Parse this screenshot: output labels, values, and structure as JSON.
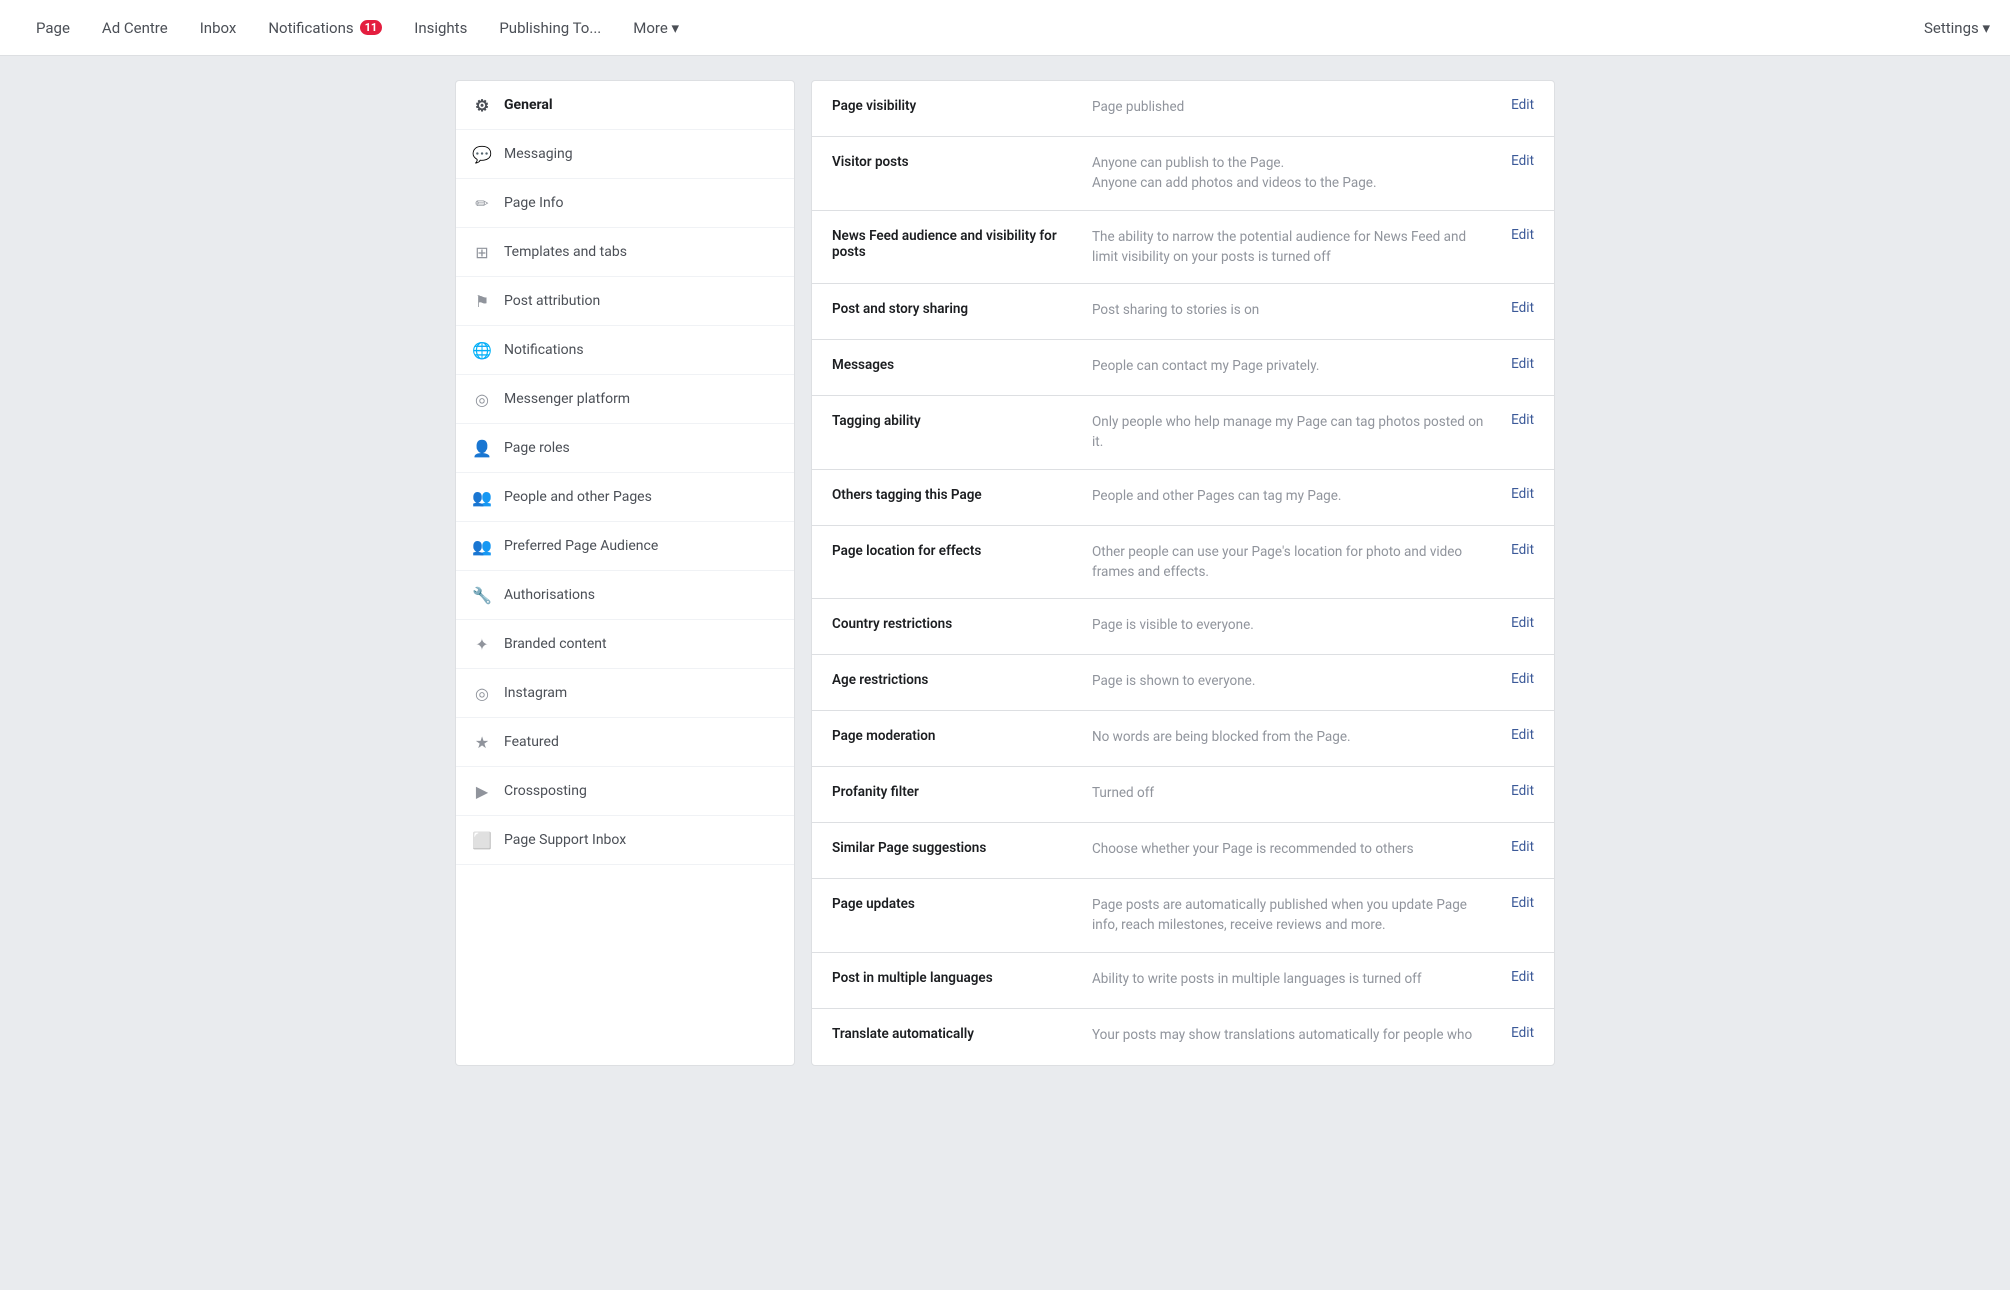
{
  "nav": {
    "items": [
      {
        "id": "page",
        "label": "Page",
        "badge": null
      },
      {
        "id": "ad-centre",
        "label": "Ad Centre",
        "badge": null
      },
      {
        "id": "inbox",
        "label": "Inbox",
        "badge": null
      },
      {
        "id": "notifications",
        "label": "Notifications",
        "badge": "11"
      },
      {
        "id": "insights",
        "label": "Insights",
        "badge": null
      },
      {
        "id": "publishing",
        "label": "Publishing To...",
        "badge": null
      },
      {
        "id": "more",
        "label": "More ▾",
        "badge": null
      }
    ],
    "settings_label": "Settings ▾"
  },
  "sidebar": {
    "items": [
      {
        "id": "general",
        "label": "General",
        "icon": "⚙",
        "active": true
      },
      {
        "id": "messaging",
        "label": "Messaging",
        "icon": "💬"
      },
      {
        "id": "page-info",
        "label": "Page Info",
        "icon": "✏"
      },
      {
        "id": "templates",
        "label": "Templates and tabs",
        "icon": "⊞"
      },
      {
        "id": "post-attribution",
        "label": "Post attribution",
        "icon": "⚑"
      },
      {
        "id": "notifications",
        "label": "Notifications",
        "icon": "🌐"
      },
      {
        "id": "messenger-platform",
        "label": "Messenger platform",
        "icon": "◎"
      },
      {
        "id": "page-roles",
        "label": "Page roles",
        "icon": "👤"
      },
      {
        "id": "people-other-pages",
        "label": "People and other Pages",
        "icon": "👥"
      },
      {
        "id": "preferred-audience",
        "label": "Preferred Page Audience",
        "icon": "👥"
      },
      {
        "id": "authorisations",
        "label": "Authorisations",
        "icon": "🔧"
      },
      {
        "id": "branded-content",
        "label": "Branded content",
        "icon": "✦"
      },
      {
        "id": "instagram",
        "label": "Instagram",
        "icon": "◎"
      },
      {
        "id": "featured",
        "label": "Featured",
        "icon": "★"
      },
      {
        "id": "crossposting",
        "label": "Crossposting",
        "icon": "▶"
      },
      {
        "id": "page-support",
        "label": "Page Support Inbox",
        "icon": "⬜"
      }
    ]
  },
  "settings": {
    "rows": [
      {
        "id": "page-visibility",
        "label": "Page visibility",
        "value": "Page published",
        "edit": "Edit"
      },
      {
        "id": "visitor-posts",
        "label": "Visitor posts",
        "value": "Anyone can publish to the Page.\nAnyone can add photos and videos to the Page.",
        "edit": "Edit"
      },
      {
        "id": "news-feed-audience",
        "label": "News Feed audience and visibility for posts",
        "value": "The ability to narrow the potential audience for News Feed and limit visibility on your posts is turned off",
        "edit": "Edit"
      },
      {
        "id": "post-story-sharing",
        "label": "Post and story sharing",
        "value": "Post sharing to stories is on",
        "edit": "Edit"
      },
      {
        "id": "messages",
        "label": "Messages",
        "value": "People can contact my Page privately.",
        "edit": "Edit"
      },
      {
        "id": "tagging-ability",
        "label": "Tagging ability",
        "value": "Only people who help manage my Page can tag photos posted on it.",
        "edit": "Edit"
      },
      {
        "id": "others-tagging",
        "label": "Others tagging this Page",
        "value": "People and other Pages can tag my Page.",
        "edit": "Edit"
      },
      {
        "id": "page-location-effects",
        "label": "Page location for effects",
        "value": "Other people can use your Page's location for photo and video frames and effects.",
        "edit": "Edit"
      },
      {
        "id": "country-restrictions",
        "label": "Country restrictions",
        "value": "Page is visible to everyone.",
        "edit": "Edit"
      },
      {
        "id": "age-restrictions",
        "label": "Age restrictions",
        "value": "Page is shown to everyone.",
        "edit": "Edit"
      },
      {
        "id": "page-moderation",
        "label": "Page moderation",
        "value": "No words are being blocked from the Page.",
        "edit": "Edit"
      },
      {
        "id": "profanity-filter",
        "label": "Profanity filter",
        "value": "Turned off",
        "edit": "Edit"
      },
      {
        "id": "similar-page-suggestions",
        "label": "Similar Page suggestions",
        "value": "Choose whether your Page is recommended to others",
        "edit": "Edit"
      },
      {
        "id": "page-updates",
        "label": "Page updates",
        "value": "Page posts are automatically published when you update Page info, reach milestones, receive reviews and more.",
        "edit": "Edit"
      },
      {
        "id": "post-multiple-languages",
        "label": "Post in multiple languages",
        "value": "Ability to write posts in multiple languages is turned off",
        "edit": "Edit"
      },
      {
        "id": "translate-automatically",
        "label": "Translate automatically",
        "value": "Your posts may show translations automatically for people who",
        "edit": "Edit"
      }
    ]
  }
}
